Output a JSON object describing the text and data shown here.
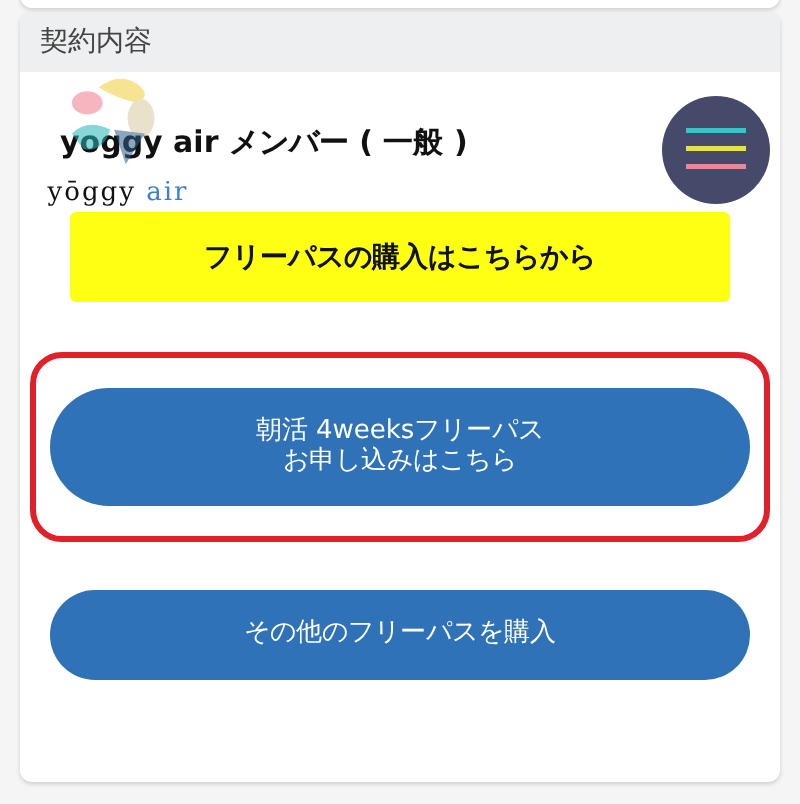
{
  "section": {
    "title": "契約内容"
  },
  "membership": {
    "label": "yoggy air メンバー ( 一般 )"
  },
  "logo": {
    "word": "yōggy",
    "accent": "air"
  },
  "buttons": [
    {
      "kind": "yellow",
      "lines": [
        "フリーパスの購入はこちらから"
      ],
      "highlighted": false
    },
    {
      "kind": "blue",
      "lines": [
        "朝活 4weeksフリーパス",
        "お申し込みはこちら"
      ],
      "highlighted": true
    },
    {
      "kind": "blue",
      "lines": [
        "その他のフリーパスを購入"
      ],
      "highlighted": false
    }
  ]
}
